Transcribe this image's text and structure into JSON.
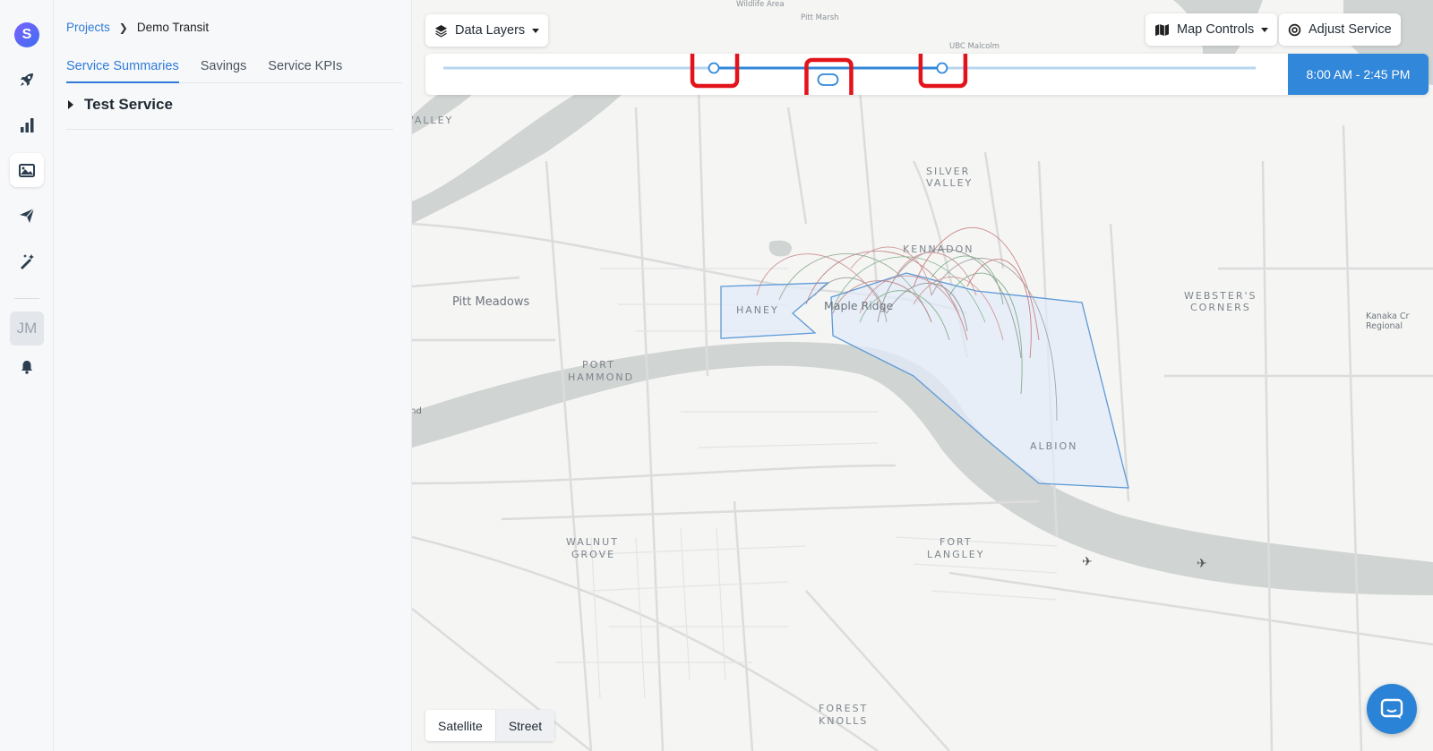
{
  "rail": {
    "logo_letter": "S",
    "avatar_initials": "JM",
    "icons": [
      "rocket-icon",
      "bar-chart-icon",
      "map-image-icon",
      "send-icon",
      "magic-wand-icon",
      "bell-icon"
    ],
    "active_icon": "map-image-icon"
  },
  "breadcrumb": {
    "parent": "Projects",
    "current": "Demo Transit"
  },
  "tabs": [
    {
      "label": "Service Summaries",
      "active": true
    },
    {
      "label": "Savings",
      "active": false
    },
    {
      "label": "Service KPIs",
      "active": false
    }
  ],
  "service_list": [
    {
      "name": "Test Service",
      "expanded": false
    }
  ],
  "map": {
    "data_layers_label": "Data Layers",
    "map_controls_label": "Map Controls",
    "adjust_service_label": "Adjust Service",
    "time_range": "8:00 AM - 2:45 PM",
    "time_range_fraction": {
      "start": 0.333,
      "end": 0.614
    },
    "map_type": {
      "options": [
        "Satellite",
        "Street"
      ],
      "selected": "Street"
    },
    "place_labels": {
      "silver_valley": [
        "SILVER",
        "VALLEY"
      ],
      "kennadon": "KENNADON",
      "websters": [
        "WEBSTER'S",
        "CORNERS"
      ],
      "pitt_meadows": "Pitt Meadows",
      "haney": "HANEY",
      "maple_ridge": "Maple Ridge",
      "port_hammond": [
        "PORT",
        "HAMMOND"
      ],
      "albion": "ALBION",
      "walnut_grove": [
        "WALNUT",
        "GROVE"
      ],
      "fort_langley": [
        "FORT",
        "LANGLEY"
      ],
      "forest_knolls": [
        "FOREST",
        "KNOLLS"
      ],
      "kanaka": [
        "Kanaka Cr",
        "Regional"
      ],
      "pitt_marsh": "Pitt Marsh",
      "ubc_malcolm": "UBC Malcolm",
      "valley": "VALLEY",
      "land": "and",
      "wildlife": "Wildlife Area"
    },
    "colors": {
      "water": "#d0d4d2",
      "road": "#dadbdb",
      "zone_fill": "#e3ebf8",
      "zone_stroke": "#5b9ad8",
      "accent": "#3187d9",
      "highlight": "#e3131b"
    }
  }
}
